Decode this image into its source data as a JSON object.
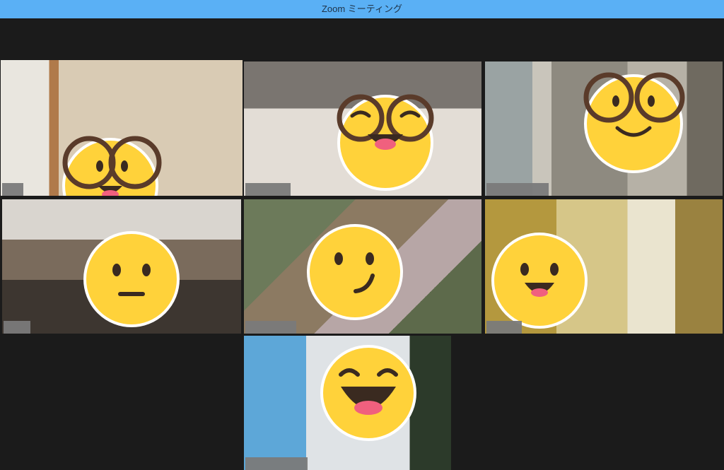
{
  "window": {
    "title": "Zoom ミーティング",
    "titlebar_color": "#5ab0f5",
    "background_color": "#1b1b1b",
    "active_speaker_color": "#c8e84a"
  },
  "participants": [
    {
      "id": "p1",
      "emoji": "emoji-glasses-tongue-icon",
      "active": true
    },
    {
      "id": "p2",
      "emoji": "emoji-glasses-grin-icon",
      "active": false
    },
    {
      "id": "p3",
      "emoji": "emoji-glasses-smile-icon",
      "active": false
    },
    {
      "id": "p4",
      "emoji": "emoji-neutral-face-icon",
      "active": false
    },
    {
      "id": "p5",
      "emoji": "emoji-smirk-face-icon",
      "active": false
    },
    {
      "id": "p6",
      "emoji": "emoji-happy-face-icon",
      "active": false
    },
    {
      "id": "p7",
      "emoji": "emoji-grinning-face-icon",
      "active": false
    }
  ]
}
